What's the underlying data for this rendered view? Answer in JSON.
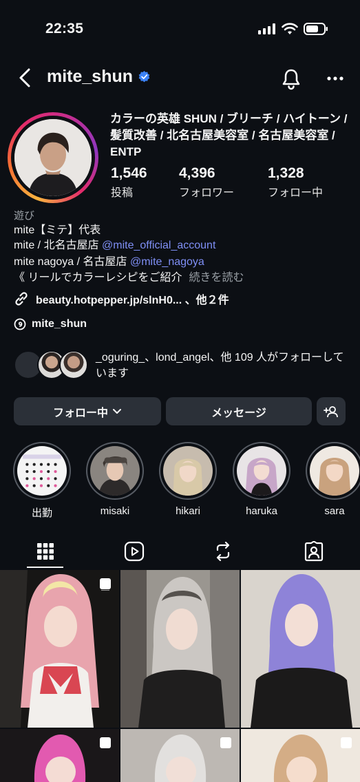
{
  "status": {
    "time": "22:35"
  },
  "header": {
    "username": "mite_shun"
  },
  "profile": {
    "headline": "カラーの英雄 SHUN / ブリーチ / ハイトーン / 髪質改善 / 北名古屋美容室 / 名古屋美容室 / ENTP",
    "stats": [
      {
        "value": "1,546",
        "label": "投稿"
      },
      {
        "value": "4,396",
        "label": "フォロワー"
      },
      {
        "value": "1,328",
        "label": "フォロー中"
      }
    ],
    "category": "遊び",
    "bio": {
      "line1": "mite【ミテ】代表",
      "line2_prefix": "mite / 北名古屋店 ",
      "line2_mention": "@mite_official_account",
      "line3_prefix": "mite nagoya / 名古屋店 ",
      "line3_mention": "@mite_nagoya",
      "line4": "《 リールでカラーレシピをご紹介",
      "read_more": "続きを読む"
    },
    "link": "beauty.hotpepper.jp/slnH0... 、他２件",
    "threads": "mite_shun",
    "followed_by": "_oguring_、lond_angel、他 109 人がフォローしています"
  },
  "buttons": {
    "following": "フォロー中",
    "message": "メッセージ"
  },
  "highlights": [
    {
      "label": "出勤"
    },
    {
      "label": "misaki"
    },
    {
      "label": "hikari"
    },
    {
      "label": "haruka"
    },
    {
      "label": "sara"
    }
  ],
  "colors": {
    "accent": "#7f8ff5",
    "verified": "#3b82f6",
    "button": "#2b3038"
  }
}
